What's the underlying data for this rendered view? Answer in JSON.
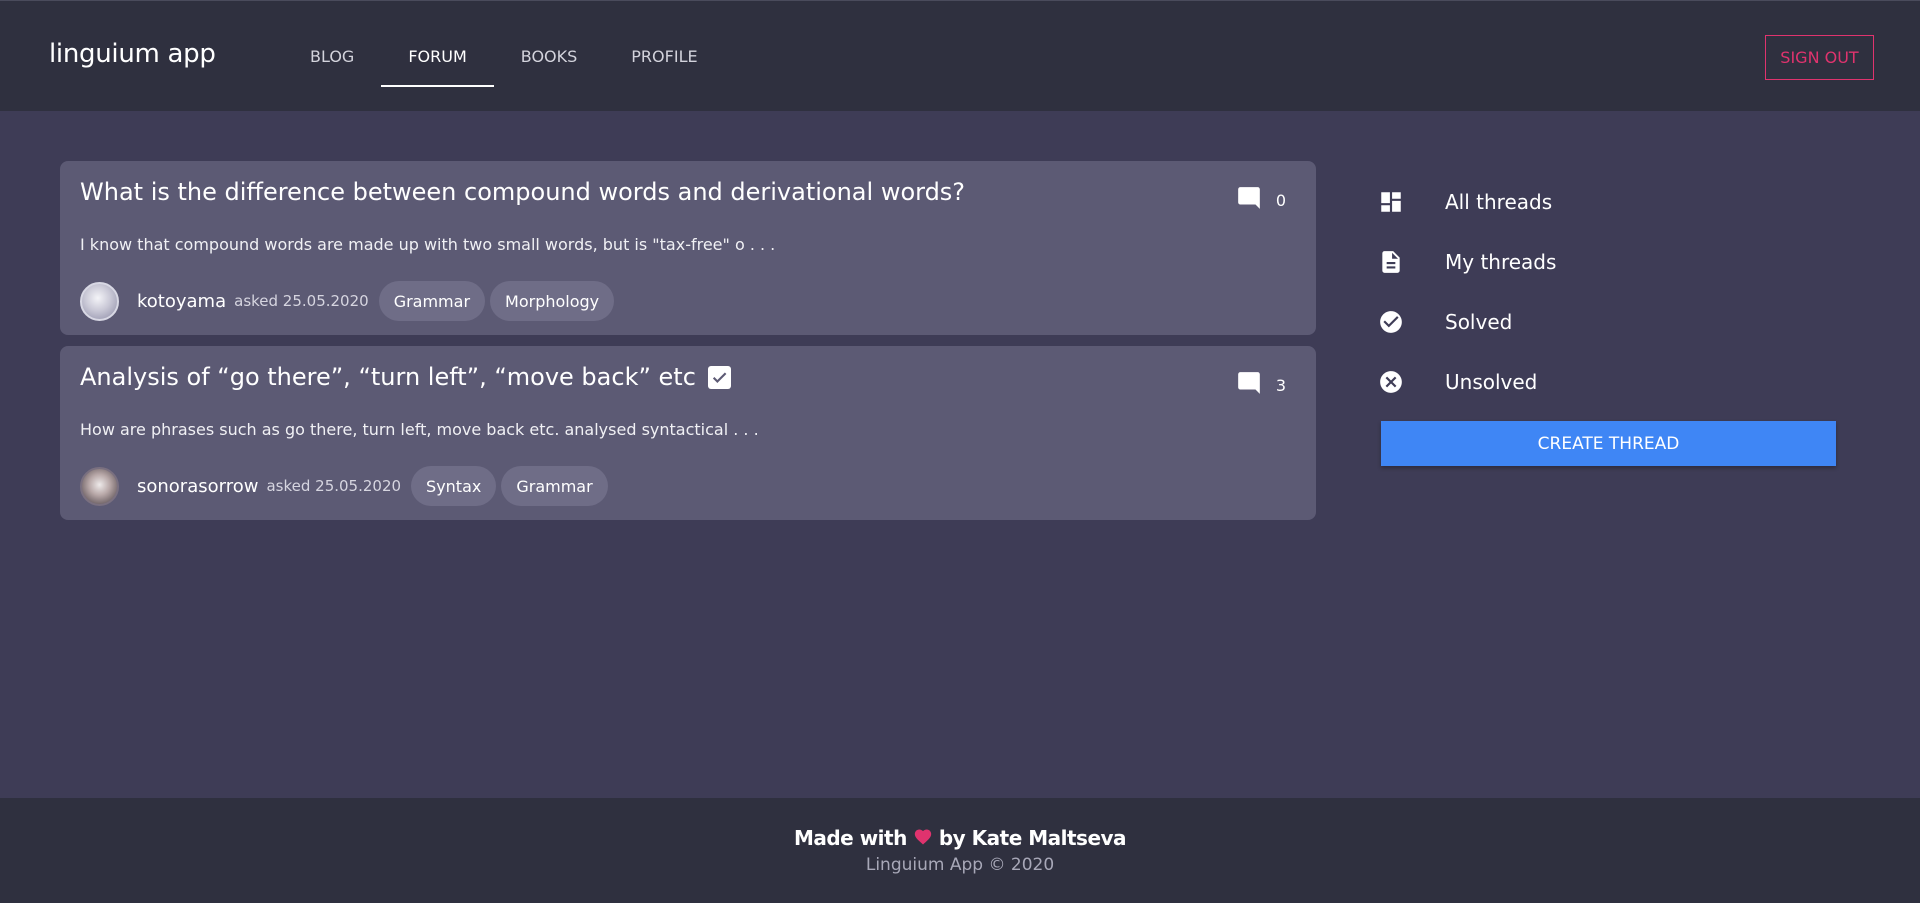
{
  "header": {
    "brand": "linguium app",
    "nav": [
      {
        "label": "BLOG",
        "active": false
      },
      {
        "label": "FORUM",
        "active": true
      },
      {
        "label": "BOOKS",
        "active": false
      },
      {
        "label": "PROFILE",
        "active": false
      }
    ],
    "sign_out": "SIGN OUT"
  },
  "threads": [
    {
      "title": "What is the difference between compound words and derivational words?",
      "solved": false,
      "comment_count": "0",
      "excerpt": "I know that compound words are made up with two small words, but is \"tax-free\" o . . .",
      "author": "kotoyama",
      "asked": "asked 25.05.2020",
      "tags": [
        "Grammar",
        "Morphology"
      ]
    },
    {
      "title": "Analysis of “go there”, “turn left”, “move back” etc",
      "solved": true,
      "comment_count": "3",
      "excerpt": "How are phrases such as go there, turn left, move back etc. analysed syntactical . . .",
      "author": "sonorasorrow",
      "asked": "asked 25.05.2020",
      "tags": [
        "Syntax",
        "Grammar"
      ]
    }
  ],
  "sidebar": {
    "items": [
      {
        "label": "All threads",
        "icon": "dashboard-icon"
      },
      {
        "label": "My threads",
        "icon": "document-icon"
      },
      {
        "label": "Solved",
        "icon": "check-circle-icon"
      },
      {
        "label": "Unsolved",
        "icon": "cancel-circle-icon"
      }
    ],
    "create_label": "CREATE THREAD"
  },
  "footer": {
    "made_prefix": "Made with",
    "made_suffix": "by Kate Maltseva",
    "copyright": "Linguium App © 2020"
  },
  "colors": {
    "page_bg": "#3e3c56",
    "header_bg": "#2f303f",
    "card_bg": "#5c5a74",
    "tag_bg": "#6f6d87",
    "accent_pink": "#e0336e",
    "button_blue": "#3f86f5"
  }
}
